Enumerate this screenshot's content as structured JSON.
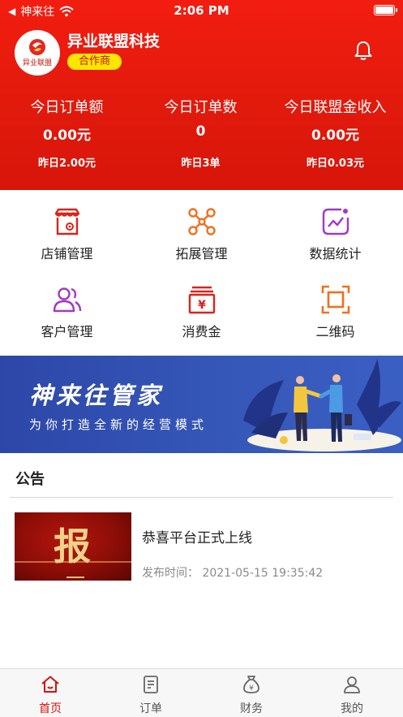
{
  "status_bar": {
    "back_label": "神来往",
    "time": "2:06 PM"
  },
  "header": {
    "logo_text": "异业联盟",
    "company_name": "异业联盟科技",
    "badge": "合作商"
  },
  "stats": [
    {
      "label": "今日订单额",
      "value": "0.00元",
      "yesterday": "昨日2.00元"
    },
    {
      "label": "今日订单数",
      "value": "0",
      "yesterday": "昨日3单"
    },
    {
      "label": "今日联盟金收入",
      "value": "0.00元",
      "yesterday": "昨日0.03元"
    }
  ],
  "menu": [
    {
      "label": "店铺管理",
      "icon": "store-icon"
    },
    {
      "label": "拓展管理",
      "icon": "network-icon"
    },
    {
      "label": "数据统计",
      "icon": "chart-icon"
    },
    {
      "label": "客户管理",
      "icon": "customers-icon"
    },
    {
      "label": "消费金",
      "icon": "coupon-icon"
    },
    {
      "label": "二维码",
      "icon": "qrcode-icon"
    }
  ],
  "banner": {
    "title": "神来往管家",
    "subtitle": "为你打造全新的经营模式"
  },
  "notice": {
    "heading": "公告",
    "articles": [
      {
        "thumb_text": "报",
        "title": "恭喜平台正式上线",
        "date": "发布时间：  2021-05-15 19:35:42"
      }
    ]
  },
  "tabs": [
    {
      "label": "首页",
      "icon": "home-icon",
      "active": true
    },
    {
      "label": "订单",
      "icon": "order-icon",
      "active": false
    },
    {
      "label": "财务",
      "icon": "money-bag-icon",
      "active": false
    },
    {
      "label": "我的",
      "icon": "user-icon",
      "active": false
    }
  ],
  "colors": {
    "brand_red": "#e11a0c",
    "badge_yellow": "#ffe600",
    "banner_blue": "#3557b8"
  }
}
